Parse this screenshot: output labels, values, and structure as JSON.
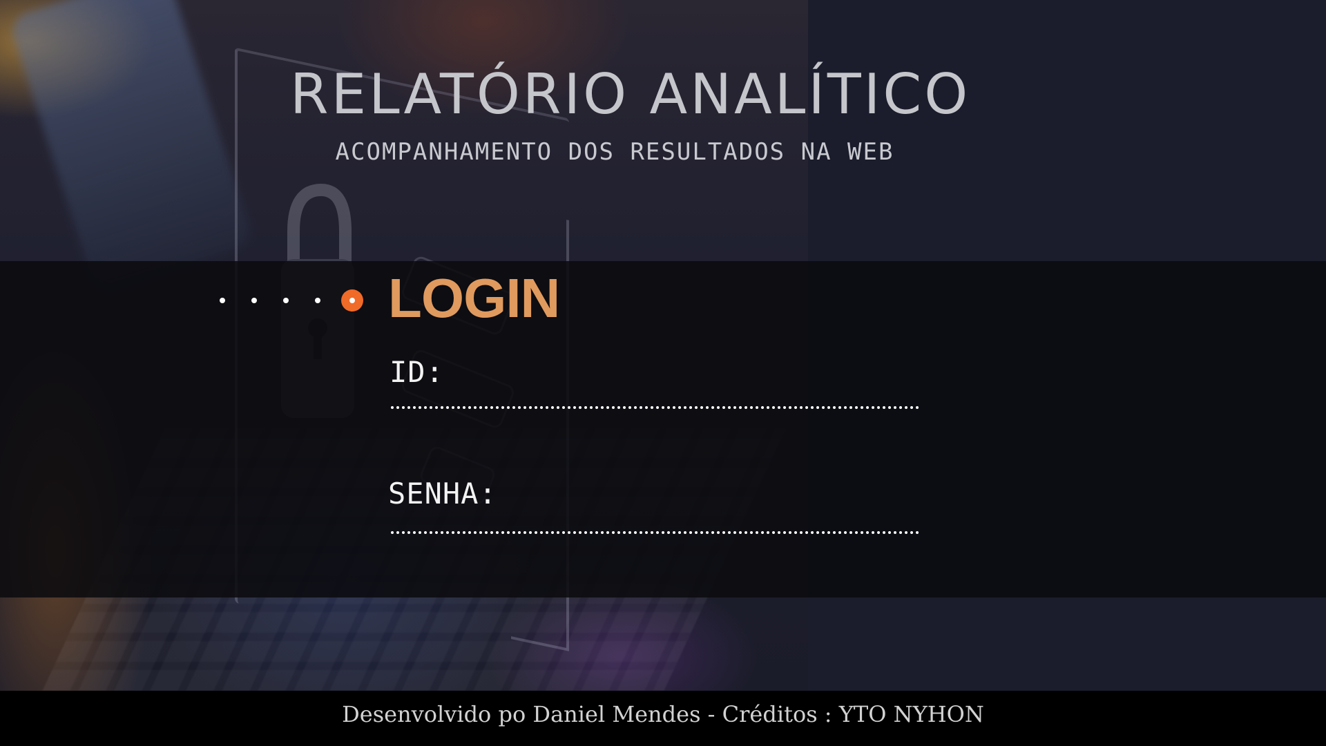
{
  "header": {
    "title": "RELATÓRIO ANALÍTICO",
    "subtitle": "ACOMPANHAMENTO DOS RESULTADOS NA WEB"
  },
  "login": {
    "heading": "LOGIN",
    "step_dots_total": 5,
    "step_dots_active": 5,
    "id_label": "ID:",
    "id_value": "",
    "password_label": "SENHA:",
    "password_value": ""
  },
  "footer": {
    "credits": "Desenvolvido po Daniel Mendes - Créditos : YTO NYHON"
  },
  "colors": {
    "accent_orange": "#f06a28",
    "heading_orange": "#e09a5e",
    "background": "#1c1e2e",
    "band": "#0a0a0e",
    "footer": "#000000"
  },
  "icons": [
    "lock-icon"
  ]
}
